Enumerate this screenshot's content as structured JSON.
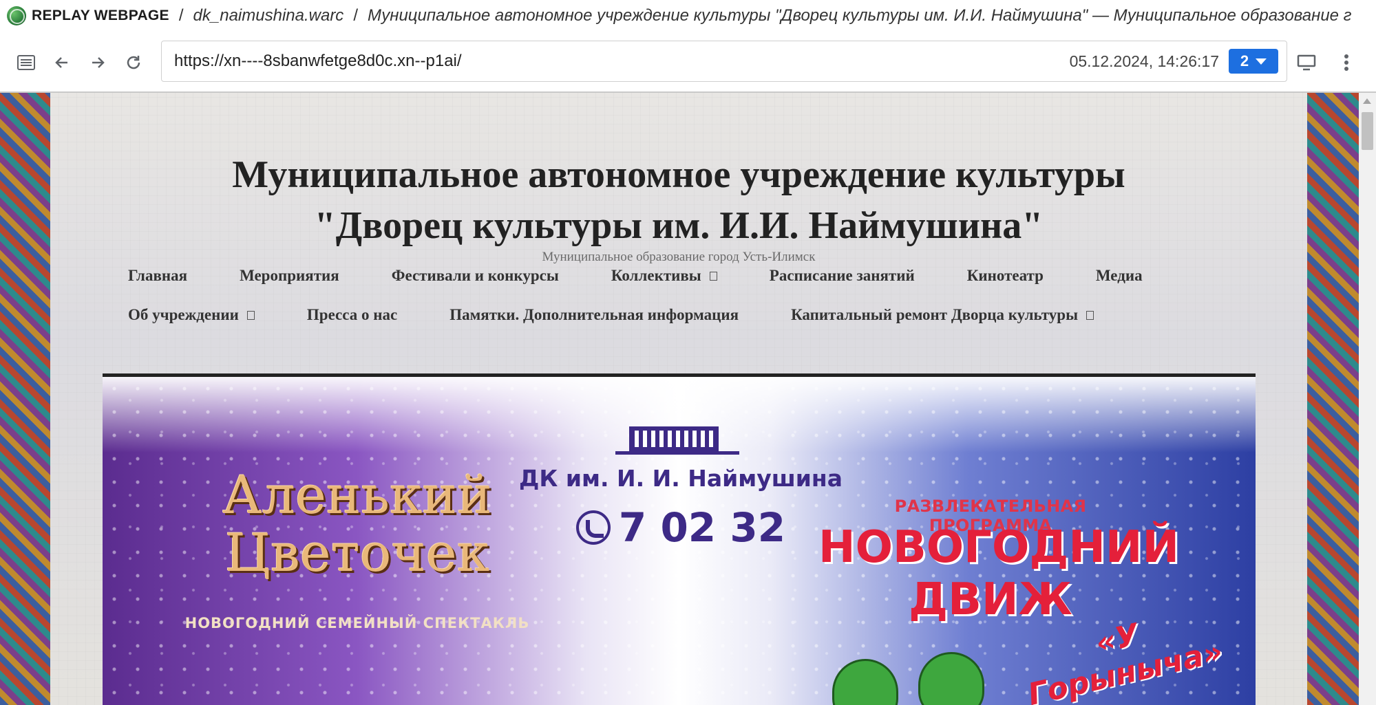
{
  "replay": {
    "brand": "REPLAY WEBPAGE",
    "archive": "dk_naimushina.warc",
    "page_title": "Муниципальное автономное учреждение культуры \"Дворец культуры им. И.И. Наймушина\" — Муниципальное образование г"
  },
  "toolbar": {
    "url": "https://xn----8sbanwfetge8d0c.xn--p1ai/",
    "timestamp": "05.12.2024, 14:26:17",
    "version": "2",
    "icons": [
      "sidebar-toggle-icon",
      "back-arrow-icon",
      "forward-arrow-icon",
      "reload-icon",
      "desktop-icon",
      "more-vert-icon"
    ]
  },
  "site": {
    "title_line1": "Муниципальное автономное учреждение культуры",
    "title_line2": "\"Дворец культуры им. И.И. Наймушина\"",
    "subtitle": "Муниципальное образование город Усть-Илимск"
  },
  "nav": {
    "row1": [
      {
        "label": "Главная"
      },
      {
        "label": "Мероприятия"
      },
      {
        "label": "Фестивали и конкурсы"
      },
      {
        "label": "Коллективы",
        "dropdown": true
      },
      {
        "label": "Расписание занятий"
      },
      {
        "label": "Кинотеатр"
      },
      {
        "label": "Медиа"
      }
    ],
    "row2": [
      {
        "label": "Об учреждении",
        "dropdown": true
      },
      {
        "label": "Пресса о нас"
      },
      {
        "label": "Памятки. Дополнительная информация"
      },
      {
        "label": "Капитальный ремонт Дворца культуры",
        "dropdown": true
      }
    ]
  },
  "banner": {
    "left_title_line1": "Аленький",
    "left_title_line2": "Цветочек",
    "left_subtitle": "НОВОГОДНИЙ СЕМЕЙНЫЙ СПЕКТАКЛЬ",
    "center_org": "ДК им. И. И. Наймушина",
    "center_phone": "7 02 32",
    "right_kicker": "РАЗВЛЕКАТЕЛЬНАЯ ПРОГРАММА",
    "right_title_line1": "НОВОГОДНИЙ",
    "right_title_line2": "ДВИЖ",
    "right_subtitle": "«У Горыныча»"
  },
  "colors": {
    "accent": "#1d6fe0",
    "banner_purple": "#3d2a86",
    "banner_red": "#e4203a",
    "banner_gold": "#e9b87a"
  }
}
